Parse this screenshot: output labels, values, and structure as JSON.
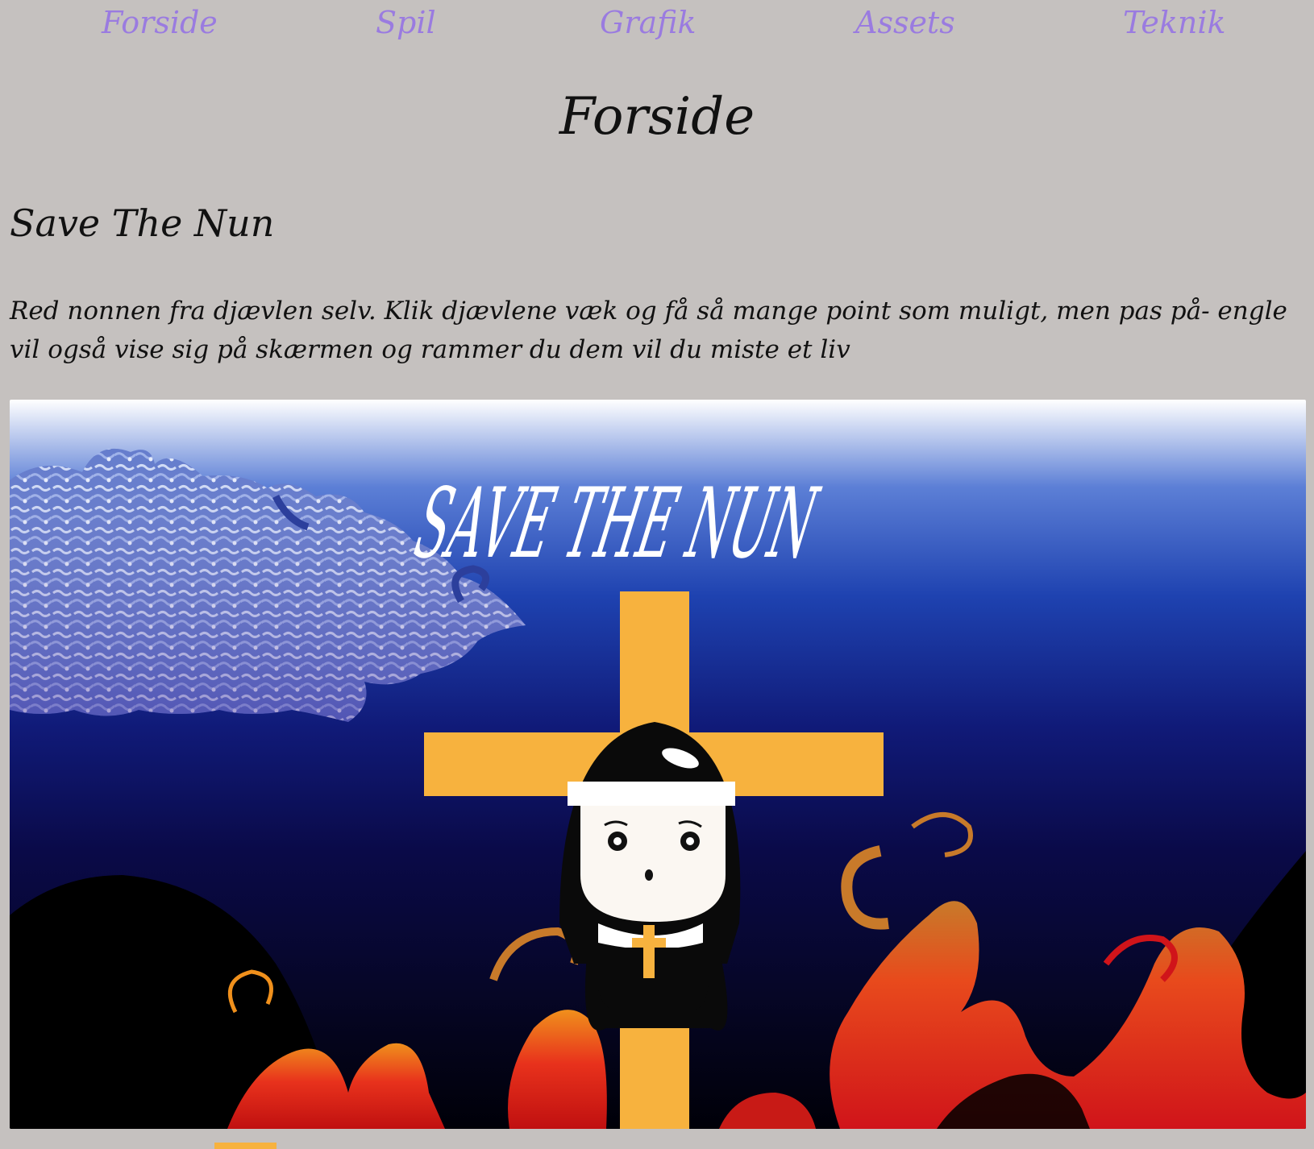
{
  "nav": {
    "items": [
      {
        "label": "Forside"
      },
      {
        "label": "Spil"
      },
      {
        "label": "Grafik"
      },
      {
        "label": "Assets"
      },
      {
        "label": "Teknik"
      }
    ]
  },
  "page": {
    "title": "Forside"
  },
  "game": {
    "title": "Save The Nun",
    "description": "Red nonnen fra djævlen selv. Klik djævlene væk og få så mange point som muligt, men pas på- engle vil også vise sig på skærmen og rammer du dem vil du miste et liv"
  },
  "banner": {
    "logo_text": "SAVE THE NUN",
    "colors": {
      "sky_top": "#ffffff",
      "sky_mid": "#1a3ea8",
      "sky_dark": "#0b0b3e",
      "cross": "#f7b23e",
      "fire_red": "#e0201a",
      "fire_orange": "#f07c1c"
    }
  }
}
